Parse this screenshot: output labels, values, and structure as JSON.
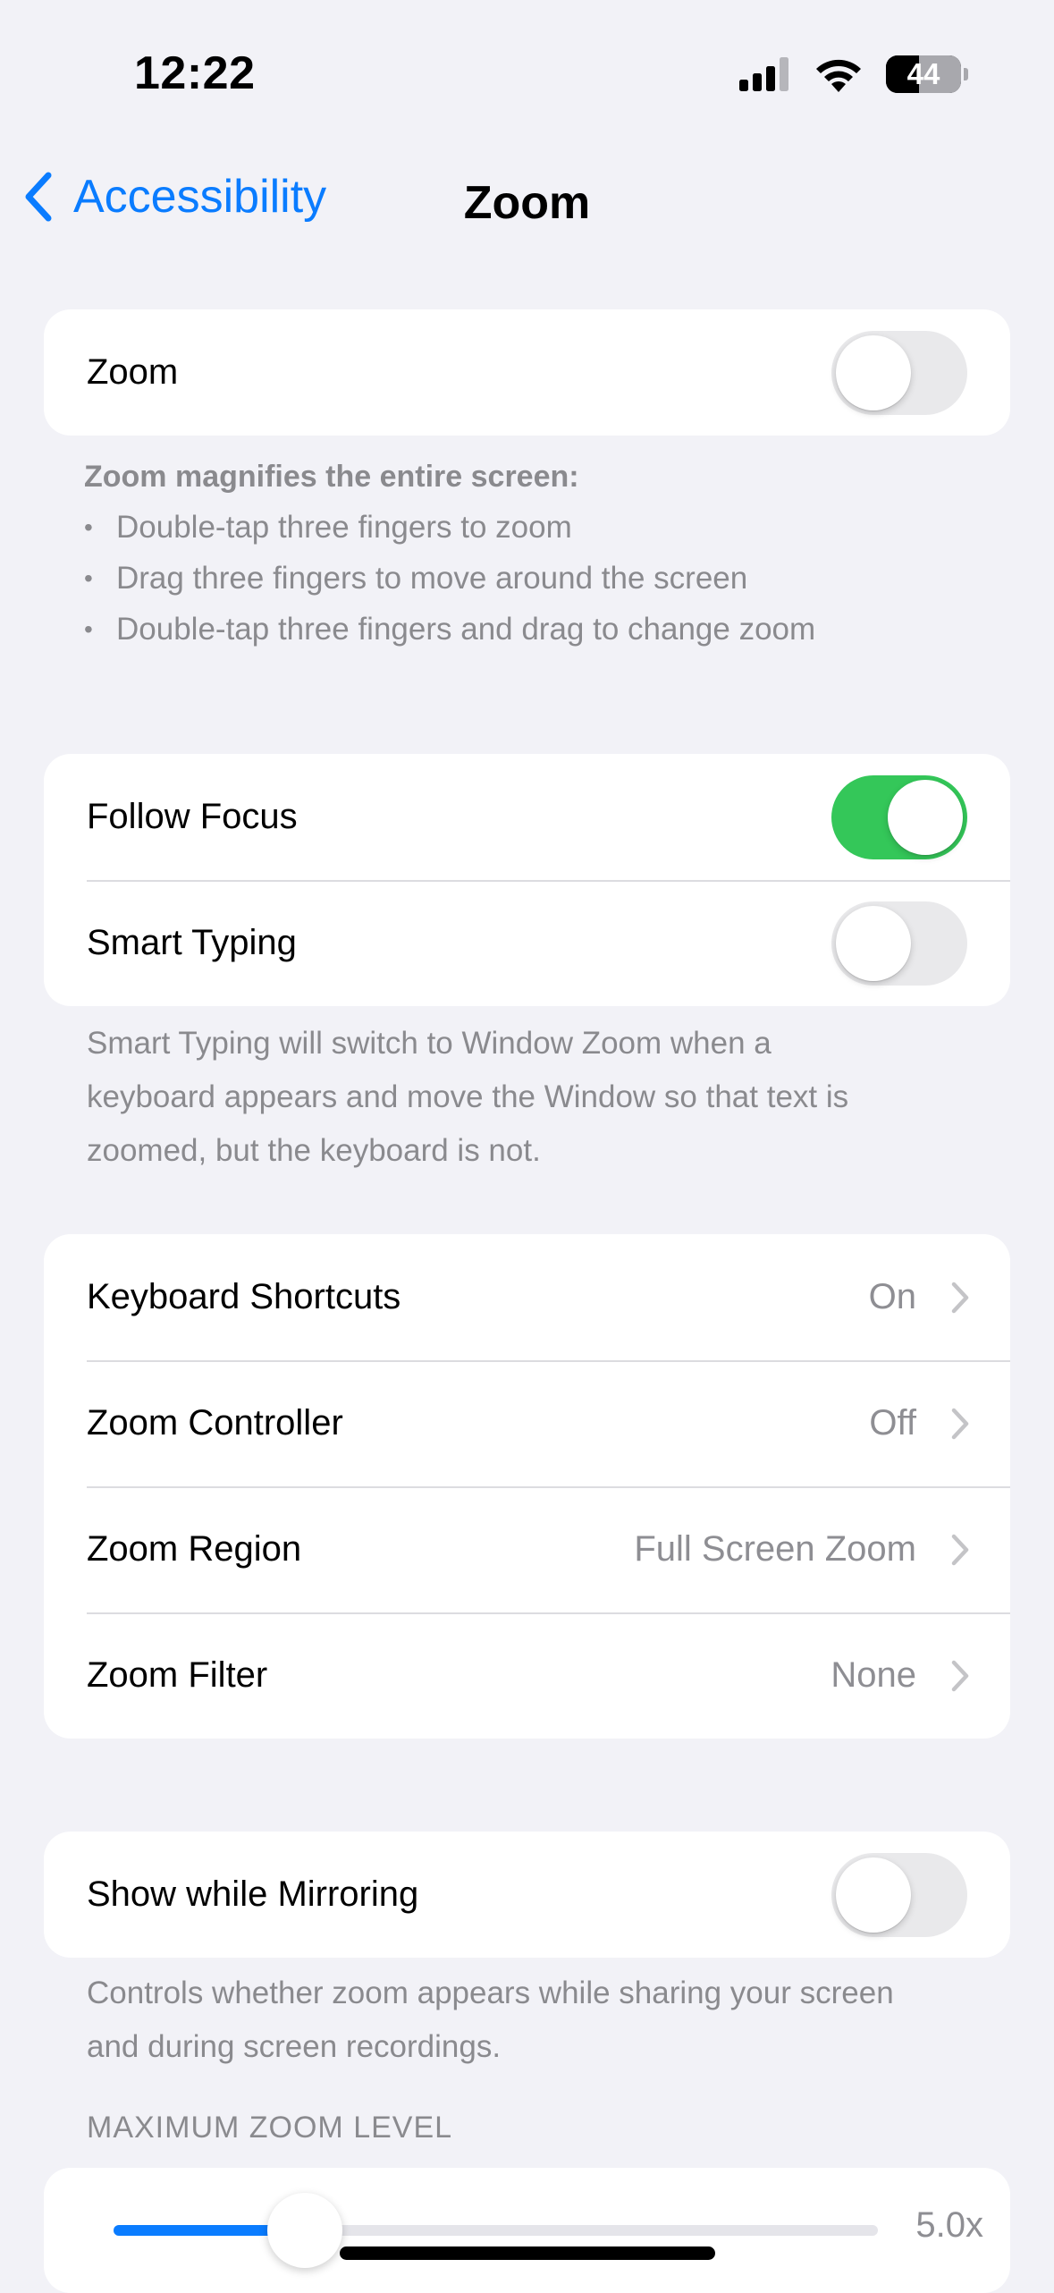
{
  "status_bar": {
    "time": "12:22",
    "battery_level": "44",
    "battery_fraction": 0.44,
    "icons": [
      "cellular-signal-icon",
      "wifi-icon",
      "battery-icon"
    ]
  },
  "nav": {
    "back_label": "Accessibility",
    "title": "Zoom",
    "back_icon": "chevron-left-icon"
  },
  "zoom_toggle": {
    "label": "Zoom",
    "on": false
  },
  "zoom_info": {
    "heading": "Zoom magnifies the entire screen:",
    "bullets": [
      "Double-tap three fingers to zoom",
      "Drag three fingers to move around the screen",
      "Double-tap three fingers and drag to change zoom"
    ]
  },
  "focus_group": {
    "follow_focus": {
      "label": "Follow Focus",
      "on": true
    },
    "smart_typing": {
      "label": "Smart Typing",
      "on": false
    },
    "footer_lines": [
      "Smart Typing will switch to Window Zoom when a",
      "keyboard appears and move the Window so that text is",
      "zoomed, but the keyboard is not."
    ]
  },
  "options_group": {
    "rows": [
      {
        "label": "Keyboard Shortcuts",
        "value": "On"
      },
      {
        "label": "Zoom Controller",
        "value": "Off"
      },
      {
        "label": "Zoom Region",
        "value": "Full Screen Zoom"
      },
      {
        "label": "Zoom Filter",
        "value": "None"
      }
    ]
  },
  "mirroring_group": {
    "show_while_mirroring": {
      "label": "Show while Mirroring",
      "on": false
    },
    "footer_lines": [
      "Controls whether zoom appears while sharing your screen",
      "and during screen recordings."
    ]
  },
  "max_zoom": {
    "header": "MAXIMUM ZOOM LEVEL",
    "value_label": "5.0x",
    "slider_fraction": 0.25
  },
  "colors": {
    "accent": "#0a7cff",
    "toggle_on": "#34c759",
    "toggle_off": "#e9e9eb",
    "background": "#f2f2f7",
    "secondary_text": "#8a8a8e"
  }
}
